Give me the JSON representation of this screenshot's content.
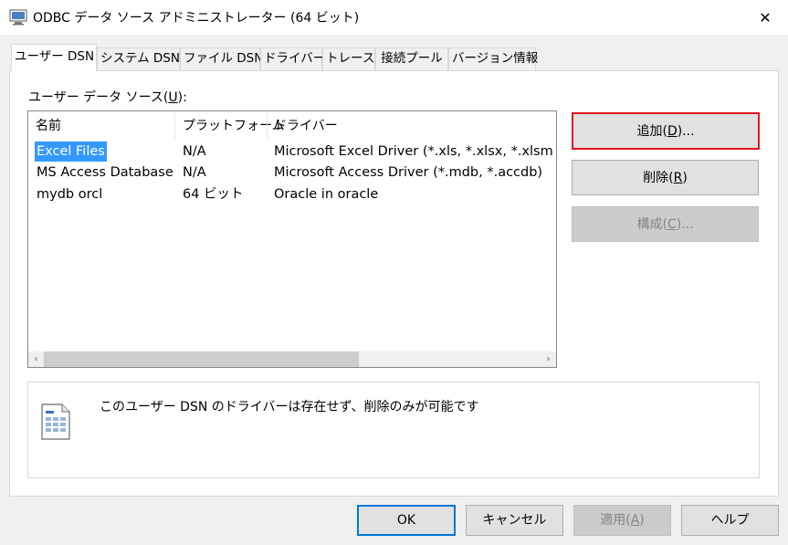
{
  "window": {
    "title": "ODBC データ ソース アドミニストレーター (64 ビット)",
    "close_glyph": "✕"
  },
  "tabs": [
    {
      "label": "ユーザー DSN",
      "active": true
    },
    {
      "label": "システム DSN",
      "active": false
    },
    {
      "label": "ファイル DSN",
      "active": false
    },
    {
      "label": "ドライバー",
      "active": false
    },
    {
      "label": "トレース",
      "active": false
    },
    {
      "label": "接続プール",
      "active": false
    },
    {
      "label": "バージョン情報",
      "active": false
    }
  ],
  "user_dsn": {
    "list_label_pre": "ユーザー データ ソース(",
    "list_label_key": "U",
    "list_label_post": "):",
    "columns": [
      "名前",
      "プラットフォーム",
      "ドライバー"
    ],
    "rows": [
      {
        "name": "Excel Files",
        "platform": "N/A",
        "driver": "Microsoft Excel Driver (*.xls, *.xlsx, *.xlsm",
        "selected": true
      },
      {
        "name": "MS Access Database",
        "platform": "N/A",
        "driver": "Microsoft Access Driver (*.mdb, *.accdb)",
        "selected": false
      },
      {
        "name": "mydb orcl",
        "platform": "64 ビット",
        "driver": "Oracle in oracle",
        "selected": false
      }
    ],
    "scroll_left": "‹",
    "scroll_right": "›",
    "buttons": {
      "add": {
        "pre": "追加(",
        "key": "D",
        "post": ")..."
      },
      "remove": {
        "pre": "削除(",
        "key": "R",
        "post": ")"
      },
      "configure": {
        "pre": "構成(",
        "key": "C",
        "post": ")..."
      }
    },
    "info_text": "このユーザー DSN のドライバーは存在せず、削除のみが可能です",
    "info_icon": "data-source-document-icon"
  },
  "footer": {
    "ok": "OK",
    "cancel": "キャンセル",
    "apply": {
      "pre": "適用(",
      "key": "A",
      "post": ")"
    },
    "help": "ヘルプ"
  },
  "colors": {
    "selection": "#3399ff",
    "focus_border": "#e0141e",
    "default_border": "#0078d7",
    "dialog_bg": "#f0f0f0"
  }
}
